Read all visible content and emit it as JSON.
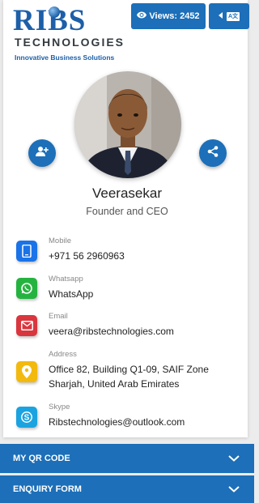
{
  "brand": {
    "logo_main": "RIBS",
    "logo_sub": "TECHNOLOGIES",
    "tagline": "Innovative Business Solutions"
  },
  "header": {
    "views_label": "Views:",
    "views_count": "2452",
    "language_glyph": "A文"
  },
  "profile": {
    "name": "Veerasekar",
    "title": "Founder and CEO"
  },
  "contacts": [
    {
      "label": "Mobile",
      "value": "+971 56 2960963",
      "icon": "phone-icon",
      "color": "#1a73e8"
    },
    {
      "label": "Whatsapp",
      "value": "WhatsApp",
      "icon": "whatsapp-icon",
      "color": "#25b340"
    },
    {
      "label": "Email",
      "value": "veera@ribstechnologies.com",
      "icon": "email-icon",
      "color": "#d9363e"
    },
    {
      "label": "Address",
      "value_line1": "Office 82, Building Q1-09, SAIF Zone",
      "value_line2": "Sharjah, United Arab Emirates",
      "icon": "location-pin-icon",
      "color": "#f2b90f"
    },
    {
      "label": "Skype",
      "value": "Ribstechnologies@outlook.com",
      "icon": "skype-icon",
      "color": "#1aa3e0"
    }
  ],
  "sections": {
    "qr_code": "MY QR CODE",
    "enquiry": "ENQUIRY FORM"
  },
  "colors": {
    "primary": "#1c6fb8",
    "background": "#ececec"
  }
}
